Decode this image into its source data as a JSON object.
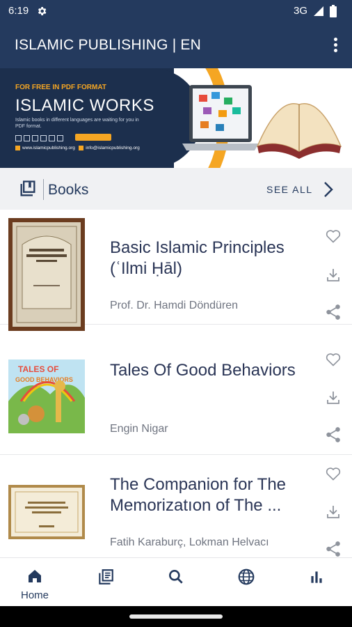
{
  "status_bar": {
    "time": "6:19",
    "network": "3G",
    "icons": [
      "gear-icon",
      "signal-icon",
      "battery-icon"
    ]
  },
  "app_bar": {
    "title": "ISLAMIC PUBLISHING | EN",
    "menu_icon": "more-vert-icon"
  },
  "banner": {
    "eyebrow": "FOR FREE IN PDF FORMAT",
    "headline": "ISLAMIC WORKS",
    "description": "Islamic books in different languages are waiting for you in PDF format.",
    "website": "www.islamicpublishing.org",
    "email": "info@islamicpublishing.org"
  },
  "section": {
    "title": "Books",
    "see_all": "SEE ALL",
    "icon": "library-books-icon"
  },
  "books": [
    {
      "title": "Basic Islamic Principles (ʿIlmi Ḥāl)",
      "author": "Prof. Dr. Hamdi Döndüren"
    },
    {
      "title": "Tales Of Good Behaviors",
      "author": "Engin Nigar"
    },
    {
      "title": "The Companion for The Memorizatıon of The Holy Qur'an",
      "title_display": "The Companion for The Memorizatıon of The ...",
      "author": "Fatih Karaburç, Lokman Helvacı"
    }
  ],
  "bottom_nav": {
    "tabs": [
      {
        "label": "Home",
        "icon": "home-icon",
        "active": true
      },
      {
        "label": "",
        "icon": "library-icon"
      },
      {
        "label": "",
        "icon": "search-icon"
      },
      {
        "label": "",
        "icon": "globe-icon"
      },
      {
        "label": "",
        "icon": "bar-chart-icon"
      }
    ]
  },
  "colors": {
    "primary": "#243a5e",
    "accent": "#f5a623",
    "background": "#ffffff",
    "section_bg": "#f0f1f3"
  }
}
